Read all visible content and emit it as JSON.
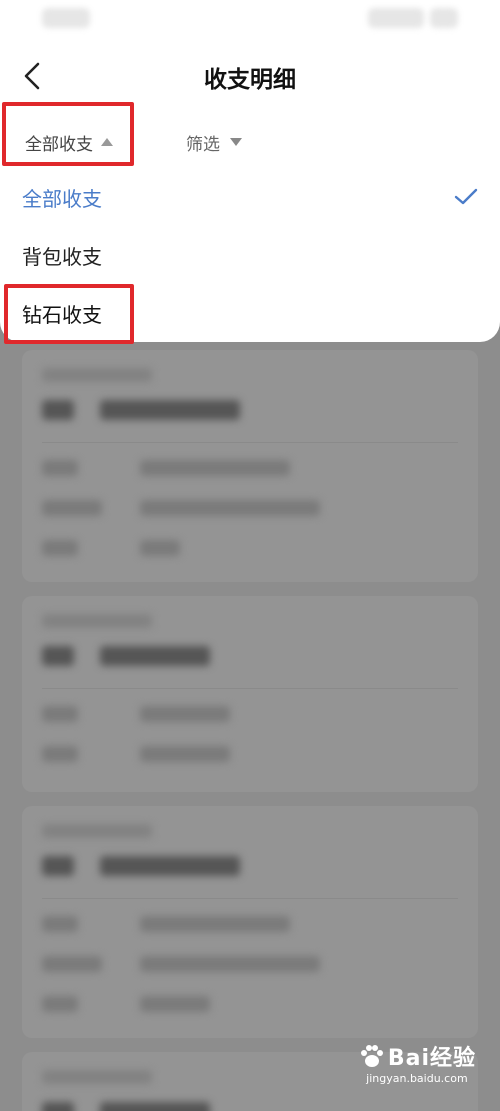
{
  "page_title": "收支明细",
  "filters": {
    "all_label": "全部收支",
    "screen_label": "筛选"
  },
  "dropdown": {
    "options": [
      {
        "label": "全部收支",
        "selected": true
      },
      {
        "label": "背包收支",
        "selected": false
      },
      {
        "label": "钻石收支",
        "selected": false
      }
    ]
  },
  "icons": {
    "back": "chevron-left-icon",
    "check": "check-icon",
    "sort_up": "triangle-up-icon",
    "sort_down": "triangle-down-icon"
  },
  "colors": {
    "accent": "#4a7cc9",
    "highlight_box": "#e0282b",
    "overlay": "#8d8d8d"
  },
  "watermark": {
    "brand": "Bai经验",
    "url": "jingyan.baidu.com"
  }
}
